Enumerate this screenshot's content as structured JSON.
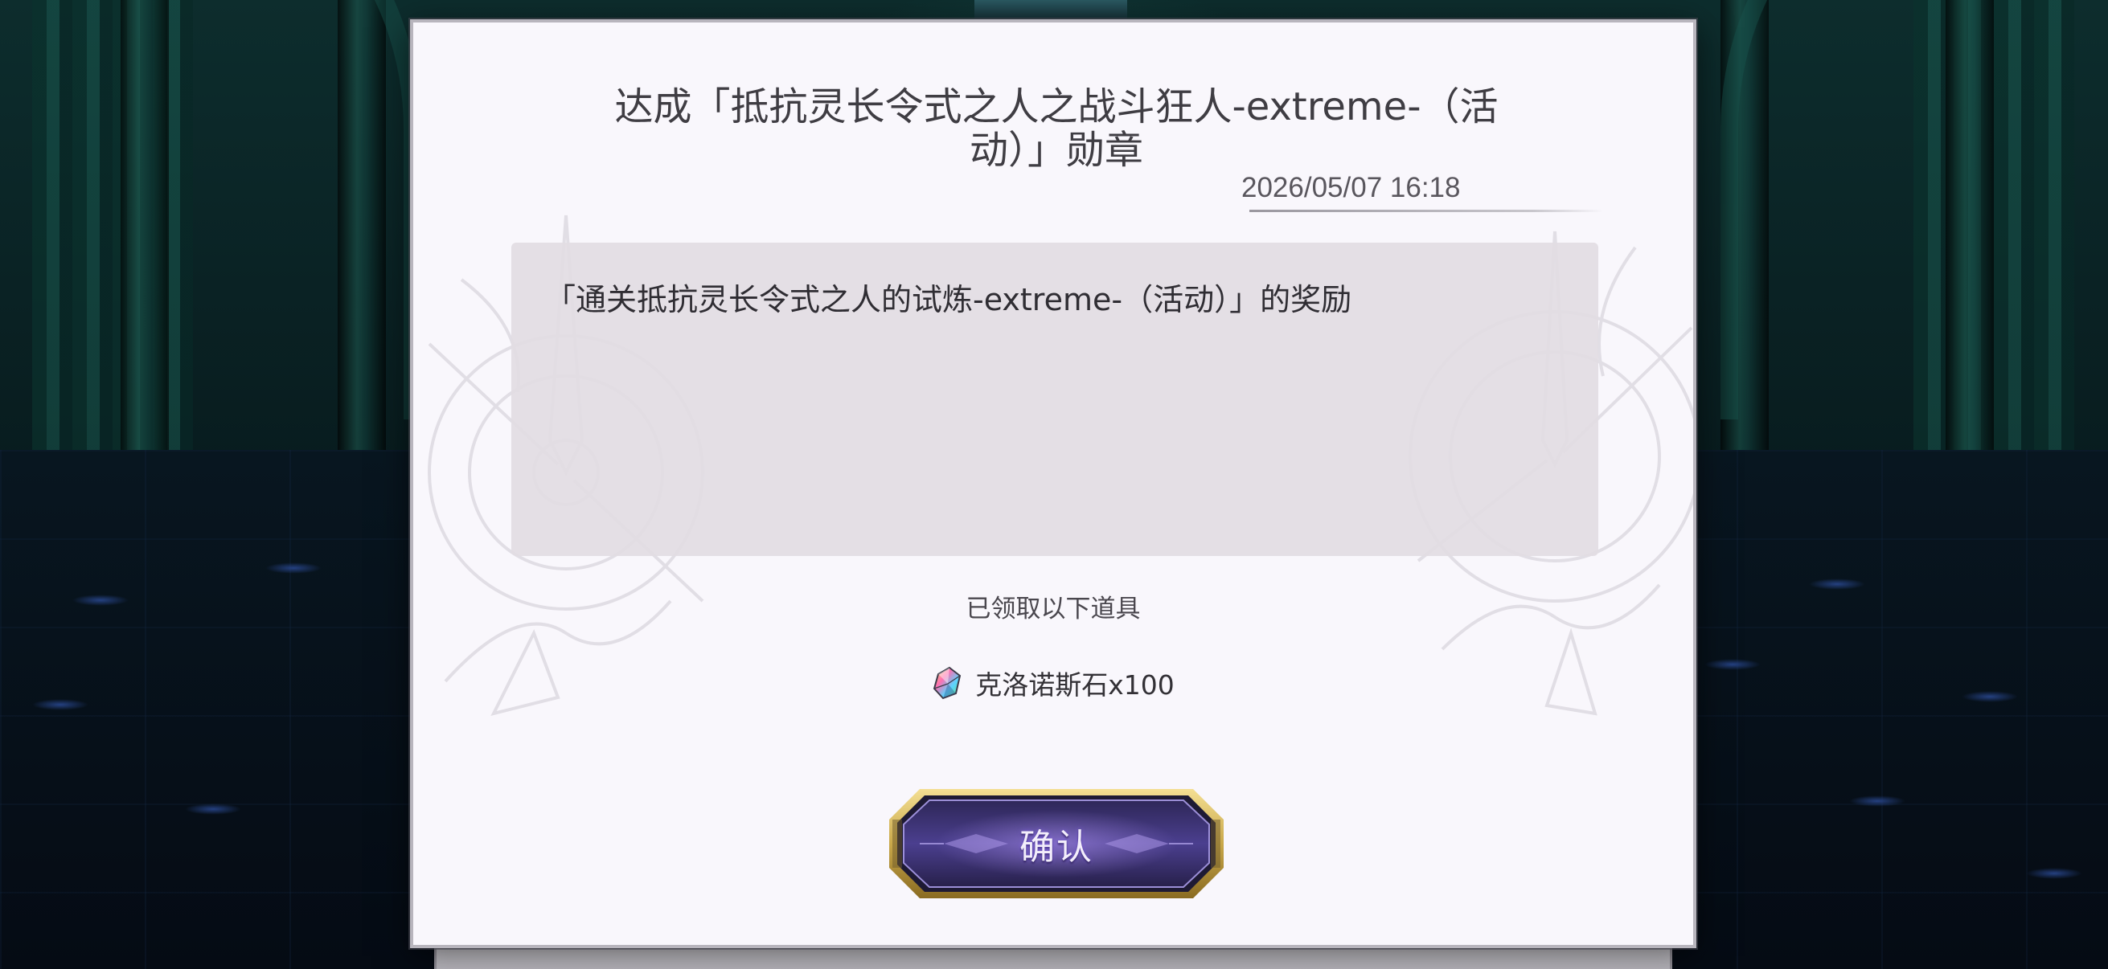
{
  "dialog": {
    "title": "达成「抵抗灵长令式之人之战斗狂人-extreme-（活动）」勋章",
    "timestamp": "2026/05/07 16:18",
    "description": "「通关抵抗灵长令式之人的试炼-extreme-（活动）」的奖励",
    "received_label": "已领取以下道具",
    "rewards": [
      {
        "icon": "chronos-stone-icon",
        "text": "克洛诺斯石x100"
      }
    ],
    "confirm_label": "确认"
  },
  "colors": {
    "dialog_background": "#f9f7fc",
    "description_background": "#e2dce3",
    "button_gold": "#c9a84a",
    "button_purple": "#4b3f8f",
    "scene_teal": "#0d2d2d"
  }
}
